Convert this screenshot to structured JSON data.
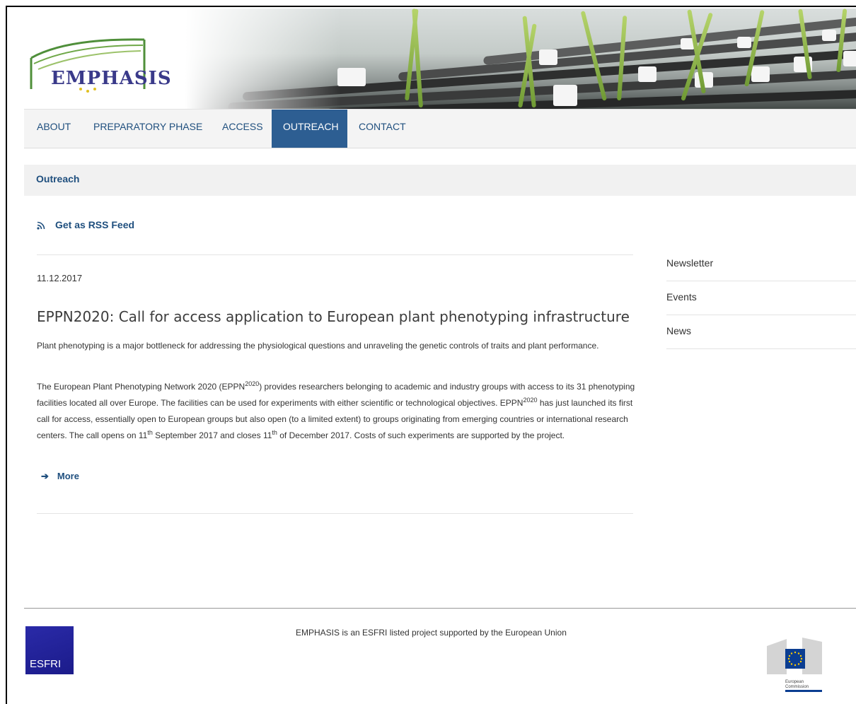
{
  "brand": {
    "logo_text": "EMPHASIS"
  },
  "nav": {
    "items": [
      {
        "label": "ABOUT"
      },
      {
        "label": "PREPARATORY PHASE"
      },
      {
        "label": "ACCESS"
      },
      {
        "label": "OUTREACH",
        "active": true
      },
      {
        "label": "CONTACT"
      }
    ]
  },
  "breadcrumb": {
    "label": "Outreach"
  },
  "rss": {
    "label": "Get as RSS Feed",
    "icon": "rss-icon"
  },
  "post": {
    "date": "11.12.2017",
    "title": "EPPN2020: Call for access application to European plant phenotyping infrastructure",
    "intro": "Plant phenotyping is a major bottleneck for addressing the physiological questions and unraveling the genetic controls of traits and plant performance.",
    "body": {
      "t1": " The European Plant Phenotyping Network 2020 (EPPN",
      "sup1": "2020",
      "t2": ") provides researchers belonging to academic and industry groups with access to its 31 phenotyping facilities located all over Europe. The facilities can be used for experiments with either scientific or technological objectives. EPPN",
      "sup2": "2020",
      "t3": " has just launched its first call for access, essentially open to European groups but also open (to a limited extent) to groups originating from emerging countries or international research centers. The call opens on 11",
      "sup3": "th",
      "t4": " September 2017 and closes 11",
      "sup4": "th",
      "t5": " of December 2017. Costs of such experiments are supported by the project."
    },
    "more_label": "More",
    "more_icon": "arrow-right-icon"
  },
  "sidebar": {
    "items": [
      {
        "label": "Newsletter"
      },
      {
        "label": "Events"
      },
      {
        "label": "News"
      }
    ]
  },
  "footer": {
    "esfri_label": "ESFRI",
    "text": "EMPHASIS is an ESFRI listed project supported by the European Union",
    "ec_label_1": "European",
    "ec_label_2": "Commission"
  },
  "colors": {
    "link": "#1f4f7e",
    "nav_active_bg": "#2d5e92",
    "esfri_blue": "#1f1f96",
    "eu_blue": "#0b3d91",
    "logo_text": "#3a3a8a"
  }
}
